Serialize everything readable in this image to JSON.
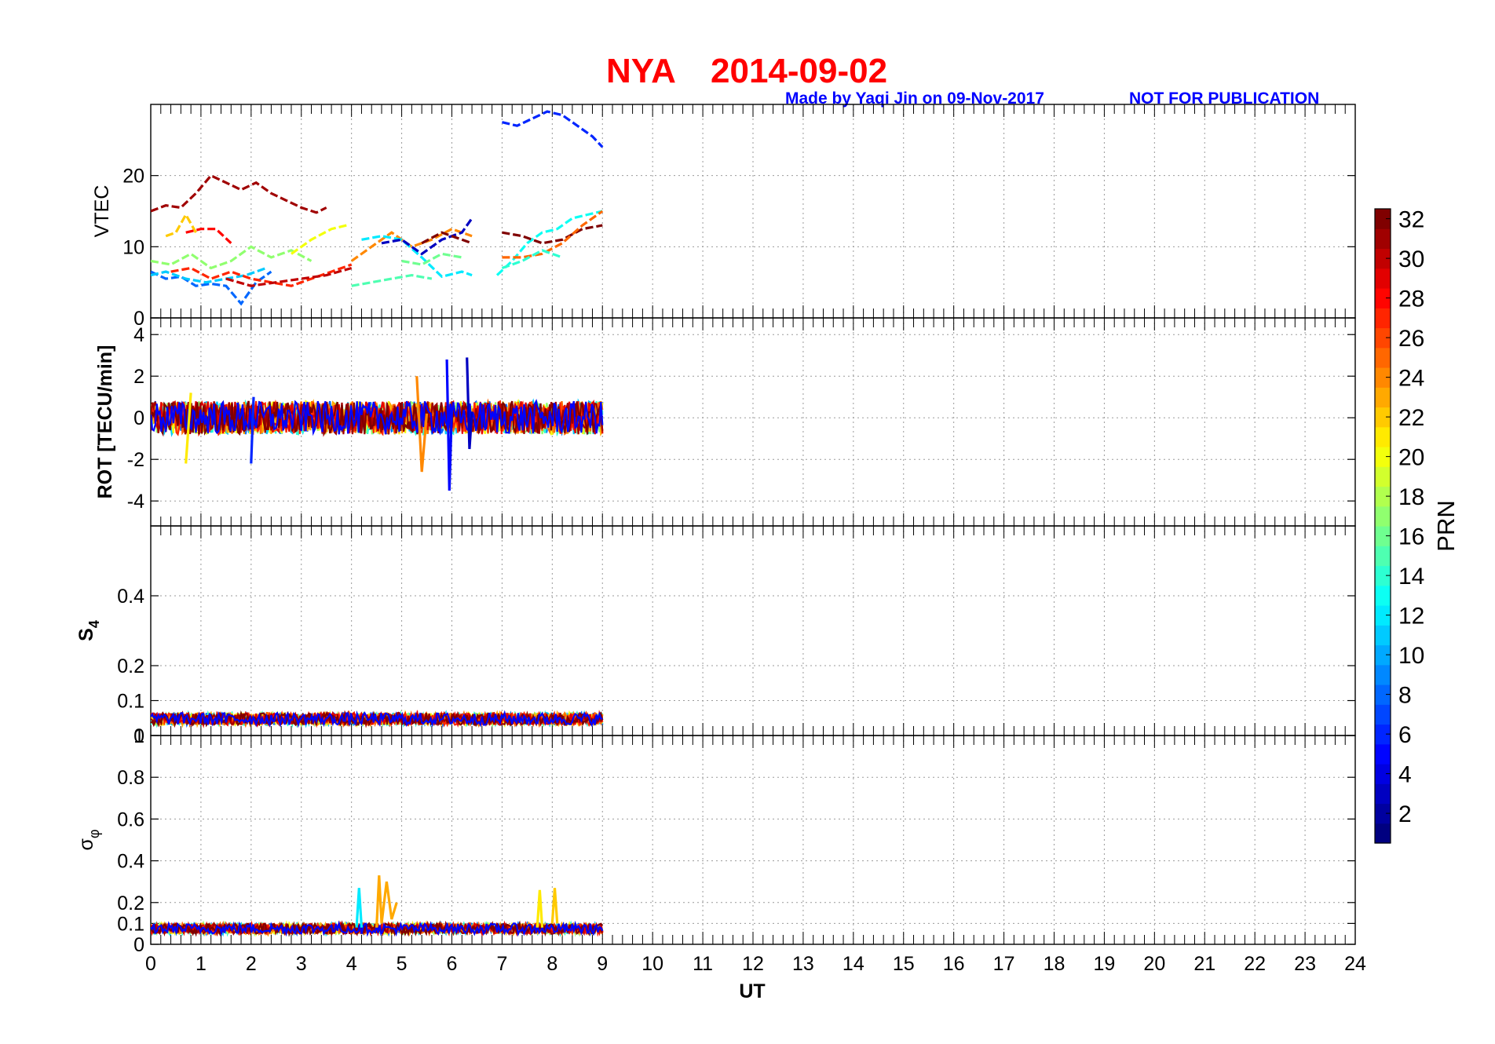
{
  "figure": {
    "title_station": "NYA",
    "title_date": "2014-09-02",
    "credit": "Made by Yaqi Jin on 09-Nov-2017",
    "notice": "NOT FOR PUBLICATION"
  },
  "chart_data": [
    {
      "type": "line",
      "panel": "VTEC",
      "ylabel": "VTEC",
      "xlabel": "UT",
      "xlim": [
        0,
        24
      ],
      "ylim": [
        0,
        30
      ],
      "yticks": [
        "0",
        "10",
        "20"
      ],
      "grid": true,
      "series": [
        {
          "prn": 31,
          "x": [
            0.0,
            0.3,
            0.6,
            0.9,
            1.2,
            1.5,
            1.8,
            2.1,
            2.4,
            2.7,
            3.0,
            3.3,
            3.5
          ],
          "y": [
            15,
            15.8,
            15.5,
            17.5,
            20,
            19,
            18,
            19,
            17.5,
            16.5,
            15.5,
            14.8,
            15.5
          ]
        },
        {
          "prn": 22,
          "x": [
            0.3,
            0.5,
            0.7,
            0.9
          ],
          "y": [
            11.5,
            12,
            14.5,
            12
          ]
        },
        {
          "prn": 28,
          "x": [
            0.7,
            1.0,
            1.3,
            1.6
          ],
          "y": [
            12,
            12.5,
            12.5,
            10.5
          ]
        },
        {
          "prn": 17,
          "x": [
            0.0,
            0.4,
            0.8,
            1.2,
            1.6,
            2.0,
            2.4,
            2.8,
            3.2
          ],
          "y": [
            8,
            7.5,
            9,
            7,
            8,
            10,
            8.5,
            9.5,
            8
          ]
        },
        {
          "prn": 20,
          "x": [
            2.8,
            3.2,
            3.6,
            3.9
          ],
          "y": [
            9,
            11,
            12.5,
            13
          ]
        },
        {
          "prn": 8,
          "x": [
            0.0,
            0.3,
            0.6,
            0.9,
            1.2,
            1.5,
            1.8,
            2.1,
            2.4
          ],
          "y": [
            6.5,
            5.5,
            5.8,
            4.5,
            4.8,
            4.5,
            2,
            5,
            6.5
          ]
        },
        {
          "prn": 11,
          "x": [
            0.0,
            0.3,
            0.7,
            1.1,
            1.5,
            1.9,
            2.3
          ],
          "y": [
            6,
            6.5,
            5.5,
            5,
            5.5,
            6,
            7
          ]
        },
        {
          "prn": 27,
          "x": [
            0.4,
            0.8,
            1.2,
            1.6,
            2.0,
            2.4,
            2.8,
            3.2,
            3.6,
            4.0
          ],
          "y": [
            6.5,
            7,
            5.5,
            6.5,
            5.5,
            5,
            4.5,
            5.5,
            6.5,
            7.5
          ]
        },
        {
          "prn": 30,
          "x": [
            1.5,
            2.0,
            2.5,
            3.0,
            3.5,
            4.0
          ],
          "y": [
            5.5,
            4.5,
            5,
            5.5,
            6,
            7
          ]
        },
        {
          "prn": 24,
          "x": [
            4.0,
            4.4,
            4.8,
            5.2,
            5.6,
            6.0,
            6.4
          ],
          "y": [
            8,
            10,
            12,
            10,
            11,
            12.5,
            11.5
          ]
        },
        {
          "prn": 15,
          "x": [
            4.0,
            4.4,
            4.8,
            5.2,
            5.6
          ],
          "y": [
            4.5,
            5,
            5.5,
            6,
            5.5
          ]
        },
        {
          "prn": 12,
          "x": [
            4.2,
            4.6,
            5.0,
            5.4,
            5.8,
            6.2,
            6.4
          ],
          "y": [
            11,
            11.5,
            11,
            8.5,
            5.8,
            6.5,
            6
          ]
        },
        {
          "prn": 3,
          "x": [
            4.6,
            5.0,
            5.4,
            5.8,
            6.2,
            6.4
          ],
          "y": [
            10.5,
            11,
            9,
            11,
            12,
            14
          ]
        },
        {
          "prn": 32,
          "x": [
            5.4,
            5.8,
            6.2,
            6.4
          ],
          "y": [
            10.5,
            12,
            11,
            10.5
          ]
        },
        {
          "prn": 16,
          "x": [
            5.0,
            5.4,
            5.8,
            6.2
          ],
          "y": [
            8,
            7.5,
            9,
            8.5
          ]
        },
        {
          "prn": 6,
          "x": [
            7.0,
            7.3,
            7.6,
            7.9,
            8.2,
            8.5,
            8.8,
            9.0
          ],
          "y": [
            27.5,
            27,
            28,
            29,
            28.5,
            27,
            25.5,
            24
          ]
        },
        {
          "prn": 13,
          "x": [
            6.9,
            7.2,
            7.5,
            7.8,
            8.1,
            8.4,
            8.7,
            9.0
          ],
          "y": [
            6,
            8,
            10.5,
            12,
            12.5,
            14,
            14.5,
            15
          ]
        },
        {
          "prn": 32,
          "x": [
            7.0,
            7.4,
            7.8,
            8.2,
            8.6,
            9.0
          ],
          "y": [
            12,
            11.5,
            10.5,
            11,
            12.5,
            13
          ]
        },
        {
          "prn": 25,
          "x": [
            7.0,
            7.4,
            7.8,
            8.2,
            8.6,
            9.0
          ],
          "y": [
            8.5,
            8.5,
            9,
            10.5,
            13,
            15
          ]
        },
        {
          "prn": 14,
          "x": [
            7.0,
            7.4,
            7.8,
            8.2
          ],
          "y": [
            7,
            8,
            9.5,
            8.5
          ]
        }
      ]
    },
    {
      "type": "line",
      "panel": "ROT",
      "ylabel": "ROT [TECU/min]",
      "xlim": [
        0,
        24
      ],
      "ylim": [
        -5.2,
        4.8
      ],
      "yticks": [
        "-4",
        "-2",
        "0",
        "2",
        "4"
      ],
      "grid": true,
      "noise_band": {
        "x_range": [
          0,
          9
        ],
        "typical_amplitude": 0.8
      },
      "series": [
        {
          "prn": 5,
          "x": [
            5.9,
            5.95,
            6.0
          ],
          "y": [
            2.8,
            -3.5,
            0.5
          ]
        },
        {
          "prn": 3,
          "x": [
            6.3,
            6.35,
            6.4
          ],
          "y": [
            2.9,
            -1.5,
            0.3
          ]
        },
        {
          "prn": 24,
          "x": [
            5.3,
            5.4,
            5.5
          ],
          "y": [
            2,
            -2.6,
            0.2
          ]
        },
        {
          "prn": 21,
          "x": [
            0.7,
            0.8
          ],
          "y": [
            -2.2,
            1.2
          ]
        },
        {
          "prn": 6,
          "x": [
            2.0,
            2.05
          ],
          "y": [
            -2.2,
            1
          ]
        }
      ]
    },
    {
      "type": "line",
      "panel": "S4",
      "ylabel": "S4",
      "xlim": [
        0,
        24
      ],
      "ylim": [
        0,
        0.6
      ],
      "yticks": [
        "0",
        "0.1",
        "0.2",
        "0.4"
      ],
      "extra_axis_label": "1",
      "grid": true,
      "noise_band": {
        "x_range": [
          0,
          9
        ],
        "typical_value": 0.04,
        "max_value": 0.1
      }
    },
    {
      "type": "line",
      "panel": "sigma_phi",
      "ylabel": "σφ",
      "xlabel": "UT",
      "xlim": [
        0,
        24
      ],
      "ylim": [
        0,
        1
      ],
      "yticks": [
        "0",
        "0.1",
        "0.2",
        "0.4",
        "0.6",
        "0.8"
      ],
      "xticks": [
        "0",
        "1",
        "2",
        "3",
        "4",
        "5",
        "6",
        "7",
        "8",
        "9",
        "10",
        "11",
        "12",
        "13",
        "14",
        "15",
        "16",
        "17",
        "18",
        "19",
        "20",
        "21",
        "22",
        "23",
        "24"
      ],
      "grid": true,
      "series": [
        {
          "prn": 23,
          "x": [
            4.5,
            4.55,
            4.6,
            4.7,
            4.8,
            4.9
          ],
          "y": [
            0.08,
            0.33,
            0.1,
            0.3,
            0.12,
            0.2
          ]
        },
        {
          "prn": 12,
          "x": [
            4.1,
            4.15,
            4.2
          ],
          "y": [
            0.08,
            0.27,
            0.08
          ]
        },
        {
          "prn": 21,
          "x": [
            7.7,
            7.75,
            7.8
          ],
          "y": [
            0.08,
            0.26,
            0.08
          ]
        },
        {
          "prn": 22,
          "x": [
            8.0,
            8.05,
            8.1
          ],
          "y": [
            0.1,
            0.27,
            0.1
          ]
        }
      ]
    }
  ],
  "colorbar": {
    "label": "PRN",
    "range": [
      1,
      32
    ],
    "ticks": [
      "2",
      "4",
      "6",
      "8",
      "10",
      "12",
      "14",
      "16",
      "18",
      "20",
      "22",
      "24",
      "26",
      "28",
      "30",
      "32"
    ]
  }
}
